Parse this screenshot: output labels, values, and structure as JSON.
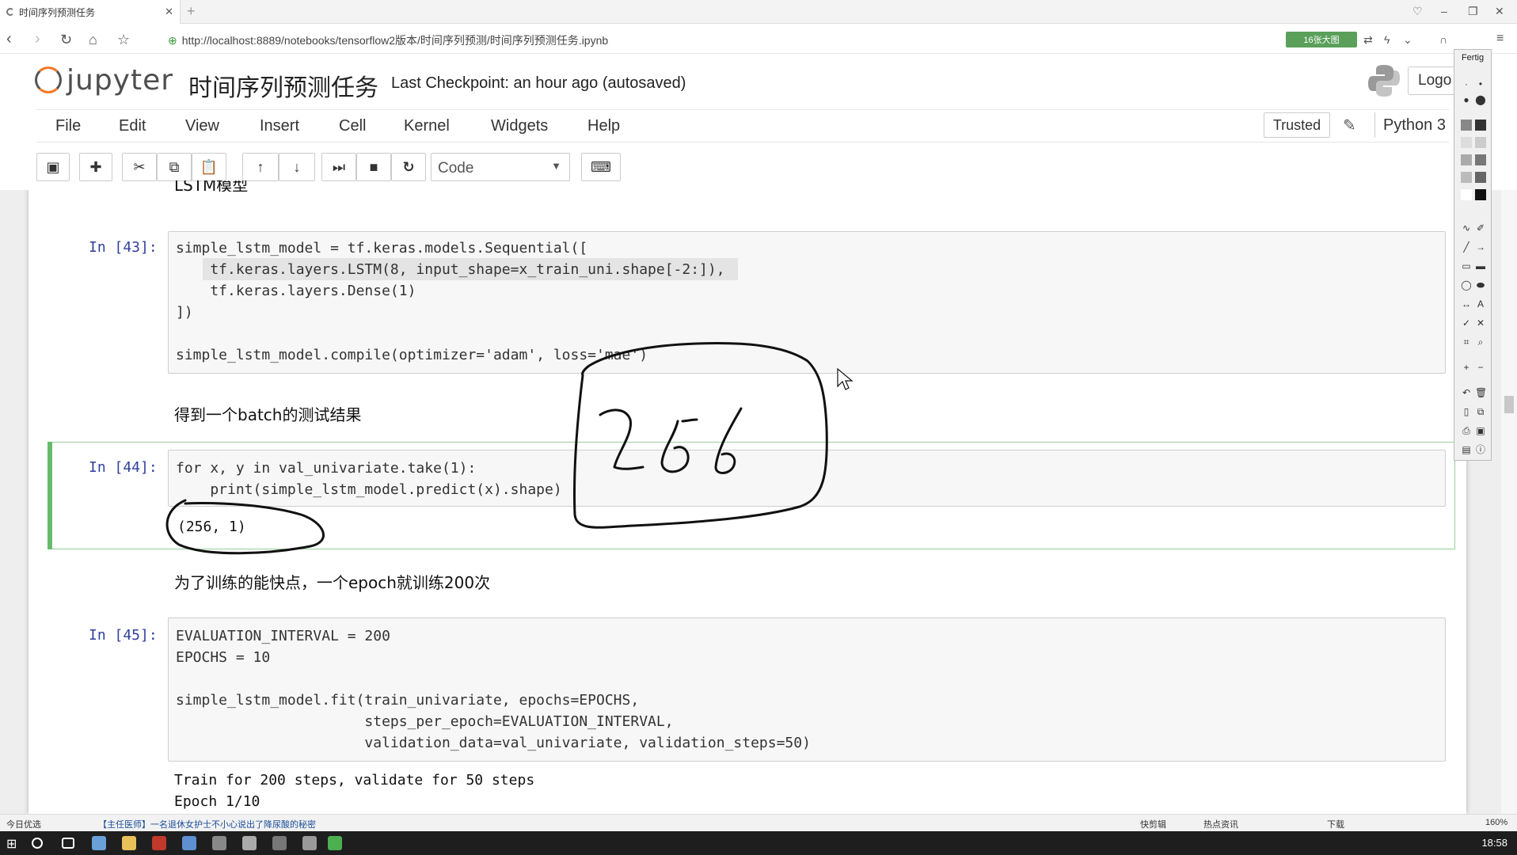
{
  "browser": {
    "tab_title": "时间序列预测任务",
    "url": "http://localhost:8889/notebooks/tensorflow2版本/时间序列预测/时间序列预测任务.ipynb",
    "zoom_pill": "16张大图"
  },
  "jupyter": {
    "logo_text": "jupyter",
    "notebook_title": "时间序列预测任务",
    "checkpoint": "Last Checkpoint: an hour ago (autosaved)",
    "logout_label": "Logo",
    "menus": [
      "File",
      "Edit",
      "View",
      "Insert",
      "Cell",
      "Kernel",
      "Widgets",
      "Help"
    ],
    "trusted_label": "Trusted",
    "kernel_name": "Python 3",
    "cell_type": "Code"
  },
  "notebook": {
    "top_heading": "LSTM模型",
    "cell43_prompt": "In [43]:",
    "cell43_lines": [
      "simple_lstm_model = tf.keras.models.Sequential([",
      "    tf.keras.layers.LSTM(8, input_shape=x_train_uni.shape[-2:]),",
      "    tf.keras.layers.Dense(1)",
      "])",
      "",
      "simple_lstm_model.compile(optimizer='adam', loss='mae')"
    ],
    "md_batch": "得到一个batch的测试结果",
    "cell44_prompt": "In [44]:",
    "cell44_lines": [
      "for x, y in val_univariate.take(1):",
      "    print(simple_lstm_model.predict(x).shape)"
    ],
    "cell44_output": "(256, 1)",
    "md_epoch": "为了训练的能快点，一个epoch就训练200次",
    "cell45_prompt": "In [45]:",
    "cell45_lines": [
      "EVALUATION_INTERVAL = 200",
      "EPOCHS = 10",
      "",
      "simple_lstm_model.fit(train_univariate, epochs=EPOCHS,",
      "                      steps_per_epoch=EVALUATION_INTERVAL,",
      "                      validation_data=val_univariate, validation_steps=50)"
    ],
    "cell45_output": [
      "Train for 200 steps, validate for 50 steps",
      "Epoch 1/10"
    ]
  },
  "annotation": {
    "handwritten_text": "256",
    "ink_color": "#111111"
  },
  "toolpanel": {
    "title": "Fertig"
  },
  "statusbar": {
    "left_label": "今日优选",
    "news": "【主任医师】一名退休女护士不小心说出了降尿酸的秘密",
    "right_items": [
      "快剪辑",
      "热点资讯",
      "下载",
      "160%"
    ]
  },
  "taskbar": {
    "time": "18:58"
  }
}
